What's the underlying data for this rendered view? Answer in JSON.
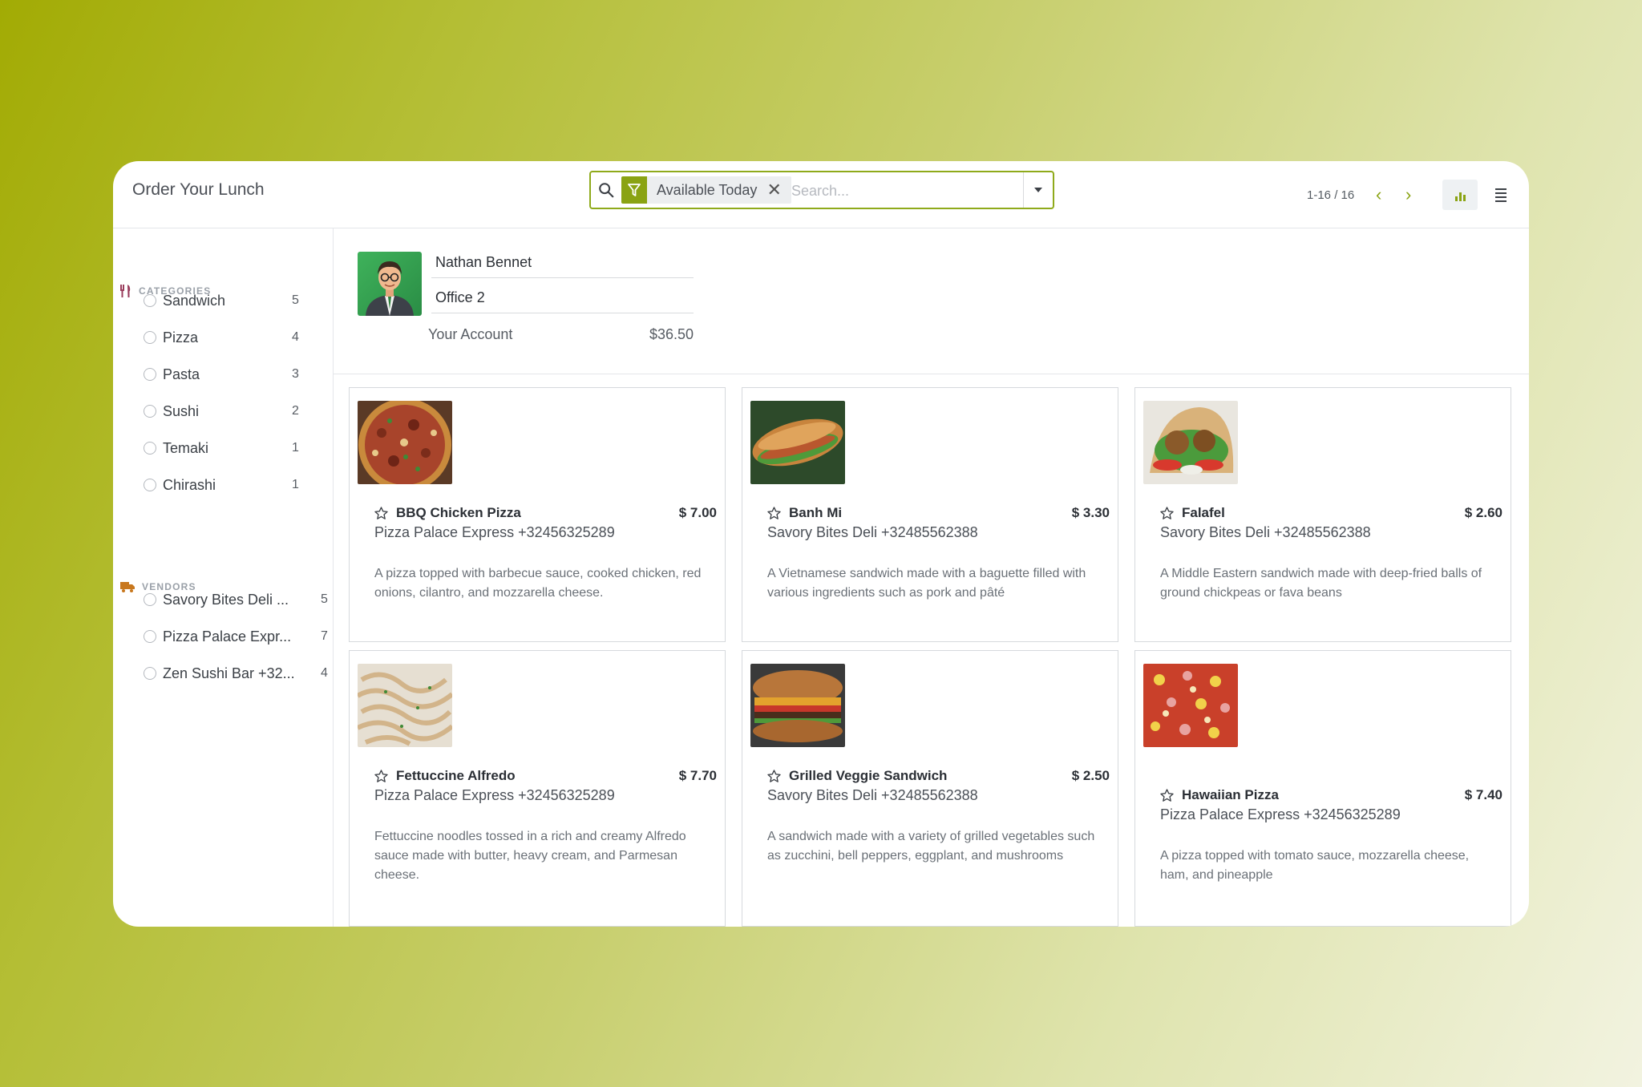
{
  "app": {
    "title": "Order Your Lunch"
  },
  "search": {
    "facet_label": "Available Today",
    "facet_remove": "✕",
    "placeholder": "Search..."
  },
  "pager": {
    "value": "1-16 / 16",
    "prev": "‹",
    "next": "›"
  },
  "sidebar": {
    "categories_title": "CATEGORIES",
    "categories": [
      {
        "label": "Sandwich",
        "count": "5"
      },
      {
        "label": "Pizza",
        "count": "4"
      },
      {
        "label": "Pasta",
        "count": "3"
      },
      {
        "label": "Sushi",
        "count": "2"
      },
      {
        "label": "Temaki",
        "count": "1"
      },
      {
        "label": "Chirashi",
        "count": "1"
      }
    ],
    "vendors_title": "VENDORS",
    "vendors": [
      {
        "label": "Savory Bites Deli ...",
        "count": "5"
      },
      {
        "label": "Pizza Palace Expr...",
        "count": "7"
      },
      {
        "label": "Zen Sushi Bar +32...",
        "count": "4"
      }
    ]
  },
  "user": {
    "name": "Nathan Bennet",
    "location": "Office 2",
    "account_label": "Your Account",
    "account_value": "$36.50"
  },
  "products": [
    {
      "name": "BBQ Chicken Pizza",
      "price": "$ 7.00",
      "vendor": "Pizza Palace Express +32456325289",
      "desc": "A pizza topped with barbecue sauce, cooked chicken, red onions, cilantro, and mozzarella cheese."
    },
    {
      "name": "Banh Mi",
      "price": "$ 3.30",
      "vendor": "Savory Bites Deli +32485562388",
      "desc": "A Vietnamese sandwich made with a baguette filled with various ingredients such as pork and pâté"
    },
    {
      "name": "Falafel",
      "price": "$ 2.60",
      "vendor": "Savory Bites Deli +32485562388",
      "desc": "A Middle Eastern sandwich made with deep-fried balls of ground chickpeas or fava beans"
    },
    {
      "name": "Fettuccine Alfredo",
      "price": "$ 7.70",
      "vendor": "Pizza Palace Express +32456325289",
      "desc": "Fettuccine noodles tossed in a rich and creamy Alfredo sauce made with butter, heavy cream, and Parmesan cheese."
    },
    {
      "name": "Grilled Veggie Sandwich",
      "price": "$ 2.50",
      "vendor": "Savory Bites Deli +32485562388",
      "desc": "A sandwich made with a variety of grilled vegetables such as zucchini, bell peppers, eggplant, and mushrooms"
    },
    {
      "name": "Hawaiian Pizza",
      "price": "$ 7.40",
      "vendor": "Pizza Palace Express +32456325289",
      "desc": "A pizza topped with tomato sauce, mozzarella cheese, ham, and pineapple"
    }
  ],
  "colors": {
    "accent": "#8aa313",
    "border": "#d6d9dd",
    "text": "#2b2f35"
  }
}
